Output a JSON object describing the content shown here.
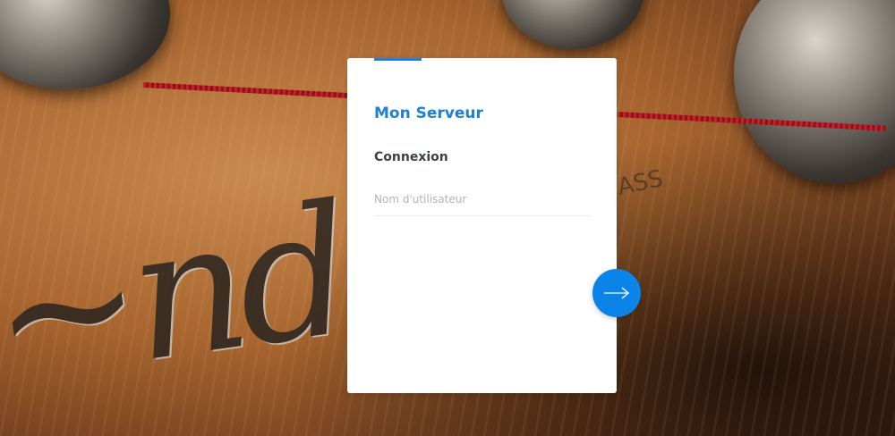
{
  "login": {
    "app_title": "Mon Serveur",
    "section_title": "Connexion",
    "username_placeholder": "Nom d'utilisateur",
    "username_value": "",
    "submit_icon": "arrow-right-icon"
  },
  "colors": {
    "accent": "#1e7fd4",
    "button": "#0a84e8",
    "card_background": "#ffffff"
  }
}
